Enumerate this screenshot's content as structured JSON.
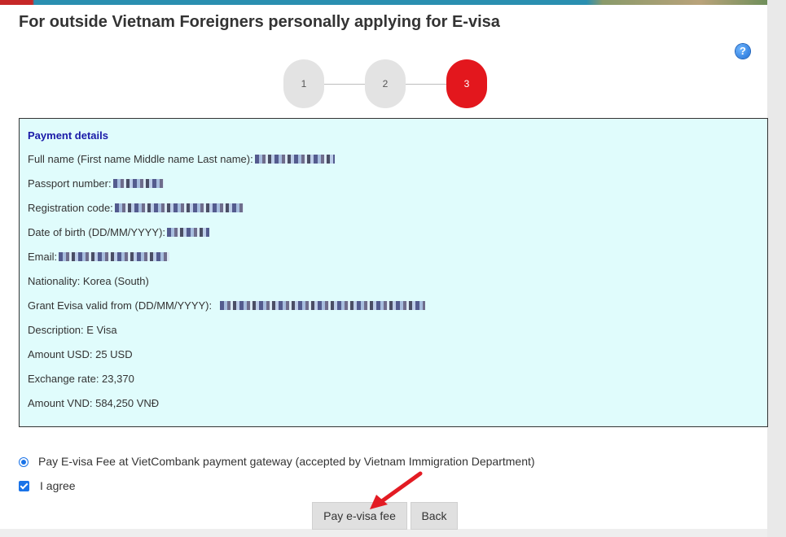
{
  "header": {
    "title": "For outside Vietnam Foreigners personally applying for E-visa",
    "help_icon": "?"
  },
  "steps": [
    {
      "label": "1",
      "active": false
    },
    {
      "label": "2",
      "active": false
    },
    {
      "label": "3",
      "active": true
    }
  ],
  "payment": {
    "heading": "Payment details",
    "rows": {
      "full_name": "Full name (First name Middle name Last name):",
      "passport": "Passport number:",
      "registration_code": "Registration code:",
      "dob": "Date of birth (DD/MM/YYYY):",
      "email": "Email:",
      "nationality": "Nationality: Korea (South)",
      "grant_evisa": "Grant Evisa valid from (DD/MM/YYYY):",
      "description": "Description: E Visa",
      "amount_usd": "Amount USD: 25 USD",
      "exchange_rate": "Exchange rate: 23,370",
      "amount_vnd": "Amount VND: 584,250 VNĐ"
    }
  },
  "options": {
    "gateway_label": "Pay E-visa Fee at VietCombank payment gateway (accepted by Vietnam Immigration Department)",
    "gateway_selected": true,
    "agree_label": "I agree",
    "agree_checked": true
  },
  "buttons": {
    "pay": "Pay e-visa fee",
    "back": "Back"
  },
  "colors": {
    "active_step": "#e3171d",
    "details_bg": "#e0fcfc",
    "heading": "#1a1aa8",
    "arrow": "#e31b23"
  }
}
